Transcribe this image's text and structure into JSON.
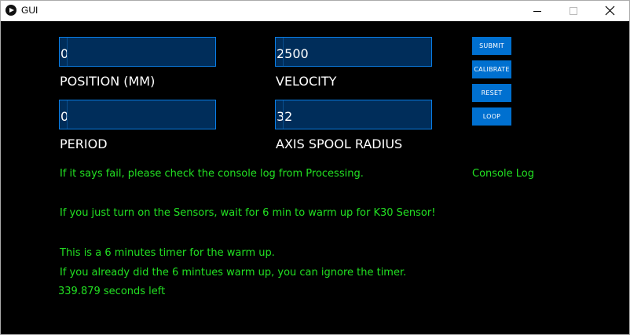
{
  "window": {
    "title": "GUI"
  },
  "fields": {
    "position": {
      "value": "0",
      "label": "POSITION (MM)"
    },
    "velocity": {
      "value": "2500",
      "label": "VELOCITY"
    },
    "period": {
      "value": "0",
      "label": "PERIOD"
    },
    "spool_radius": {
      "value": "32",
      "label": "AXIS SPOOL RADIUS"
    }
  },
  "buttons": {
    "submit": "SUBMIT",
    "calibrate": "CALIBRATE",
    "reset": "RESET",
    "loop": "LOOP"
  },
  "messages": {
    "fail_note": "If it says fail, please check the console log from Processing.",
    "console_log": "Console Log",
    "sensor_note": "If you just turn on the Sensors, wait for 6 min to warm up for K30 Sensor!",
    "timer_note": "This is a 6 minutes timer for the warm up.",
    "ignore_note": "If you already did the 6 mintues warm up, you can ignore the timer.",
    "timer_value": "339.879",
    "timer_suffix": "seconds left"
  },
  "colors": {
    "canvas_background": "#000000",
    "field_background": "#002d5a",
    "field_border": "#0a7ee6",
    "button_background": "#0070d0",
    "message_text": "#22e022",
    "label_text": "#ffffff"
  },
  "icons": {
    "app": "processing-app-icon",
    "minimize": "minimize-icon",
    "maximize": "maximize-icon",
    "close": "close-icon"
  }
}
